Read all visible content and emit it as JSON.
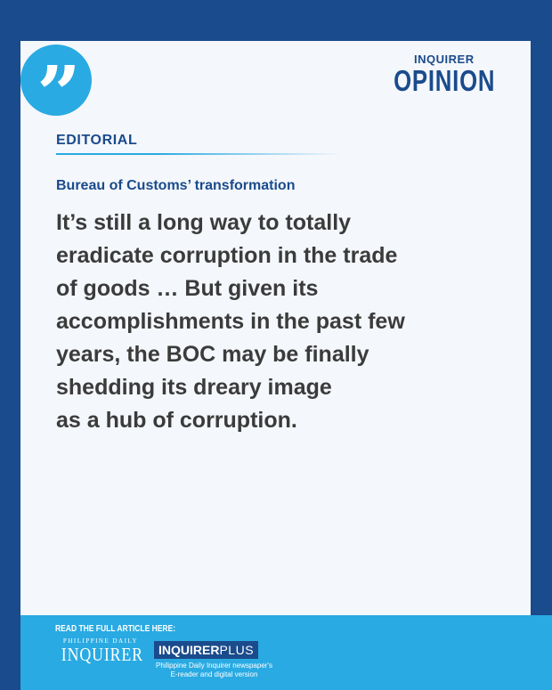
{
  "brand": {
    "small": "INQUIRER",
    "big": "OPINION"
  },
  "quote_mark": "”",
  "section_label": "EDITORIAL",
  "headline": "Bureau of Customs’ transformation",
  "quote_text": "It’s still a long way to totally\neradicate corruption in the trade\nof goods … But given its\naccomplishments in the past few\nyears, the BOC may be finally\nshedding its dreary image\nas a hub of corruption.",
  "footer": {
    "label": "READ THE FULL ARTICLE HERE:",
    "pdi_tag": "PHILIPPINE DAILY",
    "pdi_name": "INQUIRER",
    "plus_bold": "INQUIRER",
    "plus_light": "PLUS",
    "plus_sub": "Philippine Daily Inquirer newspaper's\nE-reader and digital version"
  },
  "colors": {
    "navy": "#1a4b8c",
    "sky": "#29aae2",
    "card": "#f4f7fb",
    "text": "#3b3b3b"
  }
}
